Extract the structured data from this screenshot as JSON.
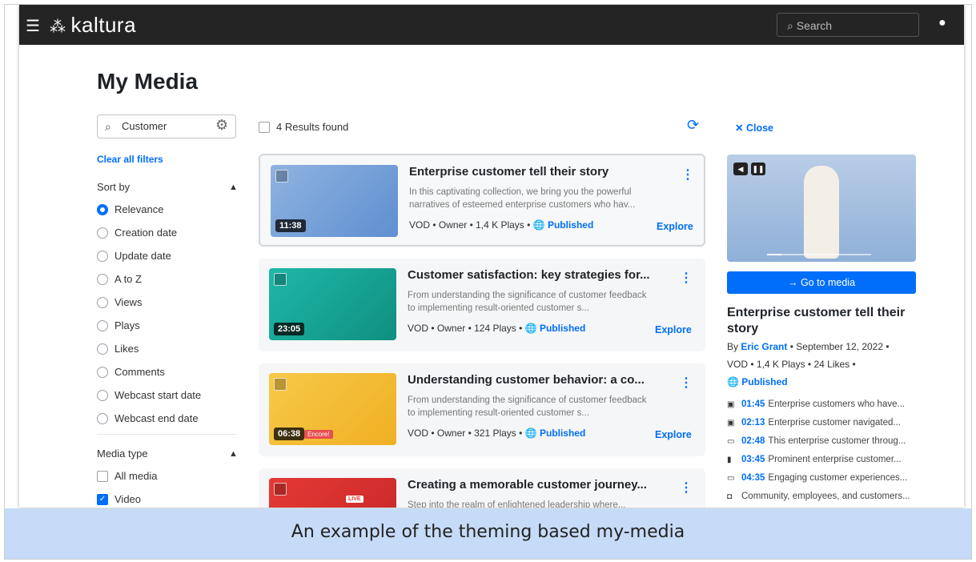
{
  "header": {
    "logo": "kaltura",
    "search_placeholder": "Search"
  },
  "page_title": "My Media",
  "filters": {
    "search_value": "Customer",
    "clear_all": "Clear all filters",
    "sort_by": "Sort by",
    "sort_options": [
      "Relevance",
      "Creation date",
      "Update date",
      "A to Z",
      "Views",
      "Plays",
      "Likes",
      "Comments",
      "Webcast start date",
      "Webcast end date"
    ],
    "media_type": "Media type",
    "media_options": [
      "All media",
      "Video"
    ]
  },
  "results": {
    "count_label": "4 Results found"
  },
  "cards": [
    {
      "title": "Enterprise customer tell their story",
      "desc": "In this captivating collection, we bring you the powerful narratives of esteemed enterprise customers who hav...",
      "duration": "11:38",
      "type": "VOD",
      "owner": "Owner",
      "plays": "1,4 K Plays",
      "status": "Published",
      "explore": "Explore"
    },
    {
      "title": "Customer satisfaction: key strategies for...",
      "desc": "From understanding the significance of customer feedback to implementing result-oriented customer s...",
      "duration": "23:05",
      "type": "VOD",
      "owner": "Owner",
      "plays": "124 Plays",
      "status": "Published",
      "explore": "Explore"
    },
    {
      "title": "Understanding customer behavior: a co...",
      "desc": "From understanding the significance of customer feedback to implementing result-oriented customer s...",
      "duration": "06:38",
      "type": "VOD",
      "owner": "Owner",
      "plays": "321 Plays",
      "status": "Published",
      "explore": "Explore",
      "thumb_tag": "Encore!"
    },
    {
      "title": "Creating a memorable customer journey...",
      "desc": "Step into the realm of enlightened leadership where...",
      "duration": "",
      "thumb_tag": "LIVE"
    }
  ],
  "panel": {
    "close": "Close",
    "goto": "Go to media",
    "title": "Enterprise customer tell their story",
    "by_prefix": "By",
    "author": "Eric Grant",
    "date": "September 12, 2022",
    "type": "VOD",
    "plays": "1,4 K Plays",
    "likes": "24 Likes",
    "status": "Published",
    "chapters": [
      {
        "icon": "cc-icon",
        "time": "01:45",
        "text": "Enterprise customers who have..."
      },
      {
        "icon": "cc-icon",
        "time": "02:13",
        "text": "Enterprise customer navigated..."
      },
      {
        "icon": "slide-icon",
        "time": "02:48",
        "text": "This enterprise customer throug..."
      },
      {
        "icon": "bookmark-icon",
        "time": "03:45",
        "text": "Prominent enterprise customer..."
      },
      {
        "icon": "slide-icon",
        "time": "04:35",
        "text": "Engaging customer experiences..."
      },
      {
        "icon": "comment-icon",
        "time": "",
        "text": "Community, employees, and customers..."
      }
    ]
  },
  "caption": "An example of the theming based my-media",
  "colors": {
    "accent": "#006efa",
    "topbar": "#242424",
    "caption_bg": "#c6dbf7"
  }
}
